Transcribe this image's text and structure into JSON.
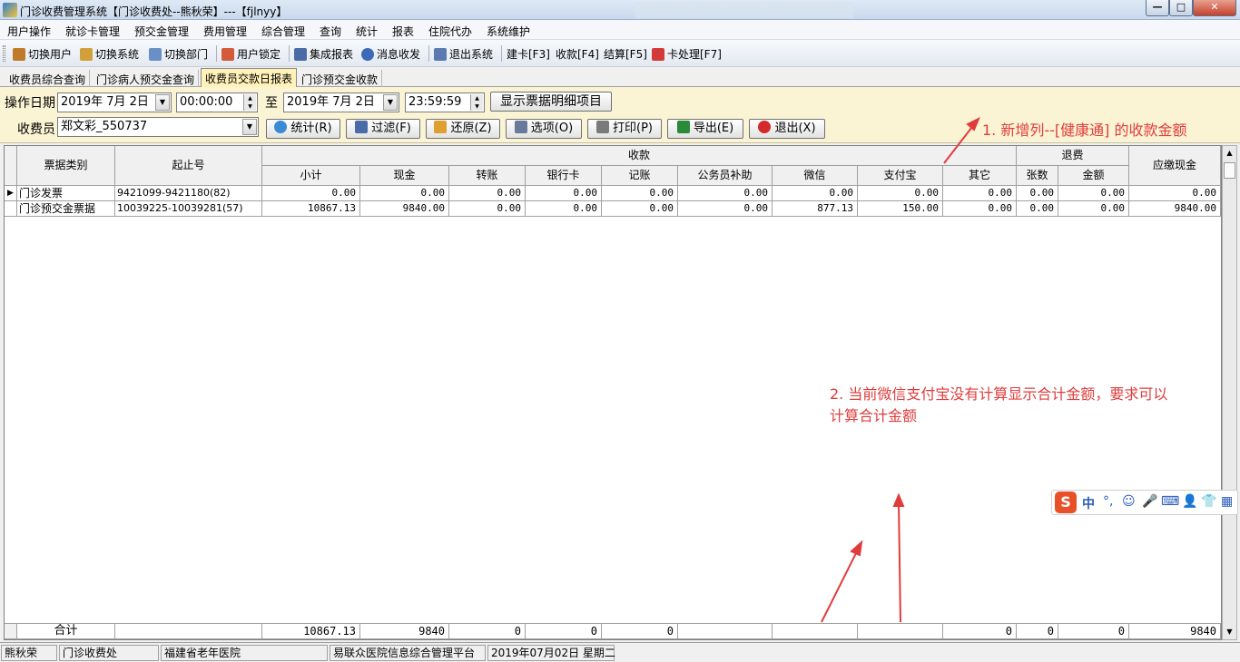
{
  "window": {
    "title": "门诊收费管理系统【门诊收费处--熊秋荣】---【fjlnyy】",
    "min_label": "—",
    "max_label": "□",
    "close_label": "✕"
  },
  "menu": [
    {
      "label": "用户操作"
    },
    {
      "label": "就诊卡管理"
    },
    {
      "label": "预交金管理"
    },
    {
      "label": "费用管理"
    },
    {
      "label": "综合管理"
    },
    {
      "label": "查询"
    },
    {
      "label": "统计"
    },
    {
      "label": "报表"
    },
    {
      "label": "住院代办"
    },
    {
      "label": "系统维护"
    }
  ],
  "toolbar": [
    {
      "label": "切换用户",
      "icon": "users-icon",
      "color": "#c07a2a"
    },
    {
      "label": "切换系统",
      "icon": "switch-icon",
      "color": "#d2a03a"
    },
    {
      "label": "切换部门",
      "icon": "department-icon",
      "color": "#6a8fc4"
    },
    {
      "label": "用户锁定",
      "icon": "user-lock-icon",
      "color": "#d45a3a"
    },
    {
      "label": "集成报表",
      "icon": "report-icon",
      "color": "#4a6aa8"
    },
    {
      "label": "消息收发",
      "icon": "info-icon",
      "color": "#3a6ab8"
    },
    {
      "label": "退出系统",
      "icon": "exit-icon",
      "color": "#5a7ab0"
    },
    {
      "label": "建卡[F3]"
    },
    {
      "label": "收款[F4]"
    },
    {
      "label": "结算[F5]"
    },
    {
      "label": "卡处理[F7]",
      "icon": "card-icon",
      "color": "#d43a3a"
    }
  ],
  "tabs": [
    {
      "label": "收费员综合查询"
    },
    {
      "label": "门诊病人预交金查询"
    },
    {
      "label": "收费员交款日报表"
    },
    {
      "label": "门诊预交金收款"
    }
  ],
  "filter": {
    "date_label": "操作日期",
    "start_date": "2019年 7月 2日",
    "start_time": "00:00:00",
    "to_label": "至",
    "end_date": "2019年 7月 2日",
    "end_time": "23:59:59",
    "detail_button": "显示票据明细项目",
    "cashier_label": "收费员",
    "cashier_value": "郑文彩_550737",
    "buttons": [
      {
        "label": "统计(R)",
        "icon": "stats-icon",
        "color": "#3a8ad4"
      },
      {
        "label": "过滤(F)",
        "icon": "filter-icon",
        "color": "#4a6aa8"
      },
      {
        "label": "还原(Z)",
        "icon": "undo-icon",
        "color": "#e0a030"
      },
      {
        "label": "选项(O)",
        "icon": "options-icon",
        "color": "#6a7a9a"
      },
      {
        "label": "打印(P)",
        "icon": "print-icon",
        "color": "#7a7a7a"
      },
      {
        "label": "导出(E)",
        "icon": "excel-icon",
        "color": "#2a8a3a"
      },
      {
        "label": "退出(X)",
        "icon": "power-icon",
        "color": "#d42a2a"
      }
    ]
  },
  "grid": {
    "col_type": "票据类别",
    "col_range": "起止号",
    "group_receive": "收款",
    "group_refund": "退费",
    "col_due_cash": "应缴现金",
    "receive_cols": [
      "小计",
      "现金",
      "转账",
      "银行卡",
      "记账",
      "公务员补助",
      "微信",
      "支付宝",
      "其它"
    ],
    "refund_cols": [
      "张数",
      "金额"
    ],
    "rows": [
      {
        "marker": "▶",
        "type": "门诊发票",
        "range": "9421099-9421180(82)",
        "values": [
          "0.00",
          "0.00",
          "0.00",
          "0.00",
          "0.00",
          "0.00",
          "0.00",
          "0.00",
          "0.00",
          "0.00",
          "0.00",
          "0.00"
        ]
      },
      {
        "marker": "",
        "type": "门诊预交金票据",
        "range": "10039225-10039281(57)",
        "values": [
          "10867.13",
          "9840.00",
          "0.00",
          "0.00",
          "0.00",
          "0.00",
          "877.13",
          "150.00",
          "0.00",
          "0.00",
          "0.00",
          "9840.00"
        ]
      }
    ],
    "total_label": "合计",
    "totals": [
      "10867.13",
      "9840",
      "0",
      "0",
      "0",
      "",
      "",
      "",
      "0",
      "0",
      "0",
      "9840"
    ]
  },
  "annotations": {
    "note1": "1. 新增列--[健康通] 的收款金额",
    "note2_line1": "2. 当前微信支付宝没有计算显示合计金额，要求可以",
    "note2_line2": "计算合计金额",
    "color": "#e03c3c"
  },
  "ime": {
    "logo": "S",
    "items": [
      "中",
      "°,",
      "☺",
      "🎤",
      "⌨",
      "👤",
      "👕",
      "▦"
    ]
  },
  "status": [
    {
      "label": "熊秋荣"
    },
    {
      "label": "门诊收费处"
    },
    {
      "label": "福建省老年医院"
    },
    {
      "label": "易联众医院信息综合管理平台"
    },
    {
      "label": "2019年07月02日 星期二"
    }
  ]
}
